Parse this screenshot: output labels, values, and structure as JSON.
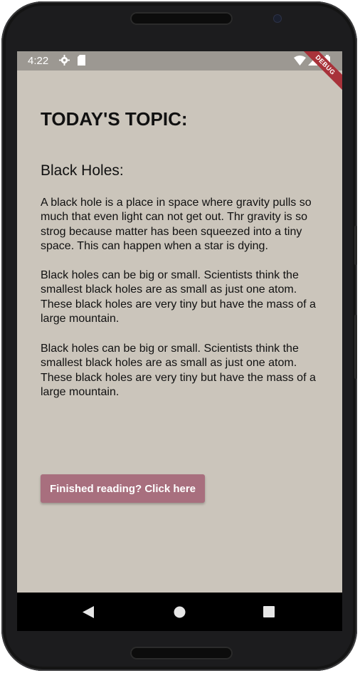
{
  "status_bar": {
    "time": "4:22",
    "icons": [
      "settings-icon",
      "sd-card-icon",
      "wifi-icon",
      "signal-icon",
      "battery-icon"
    ],
    "debug_label": "DEBUG"
  },
  "content": {
    "topic_title": "TODAY'S TOPIC:",
    "section_heading": "Black Holes:",
    "paragraphs": [
      "A black hole is a place in space where gravity pulls so much that even light can not get out. Thr gravity is so strog because matter has been squeezed into a tiny space. This can happen when a star is dying.",
      "Black holes can be big or small. Scientists think the smallest black holes are as small as just one atom. These black holes are very tiny but have the mass of a large mountain.",
      "Black holes can be big or small. Scientists think the smallest black holes are as small as just one atom. These black holes are very tiny but have the mass of a large mountain."
    ]
  },
  "finish_button": {
    "label": "Finished reading? Click here"
  },
  "nav_bar": {
    "icons": [
      "back-icon",
      "home-icon",
      "recents-icon"
    ]
  },
  "colors": {
    "screen_background": "#cbc5bb",
    "status_bar": "#9c9892",
    "button": "#a86f7e",
    "debug_ribbon": "#a8323a"
  }
}
